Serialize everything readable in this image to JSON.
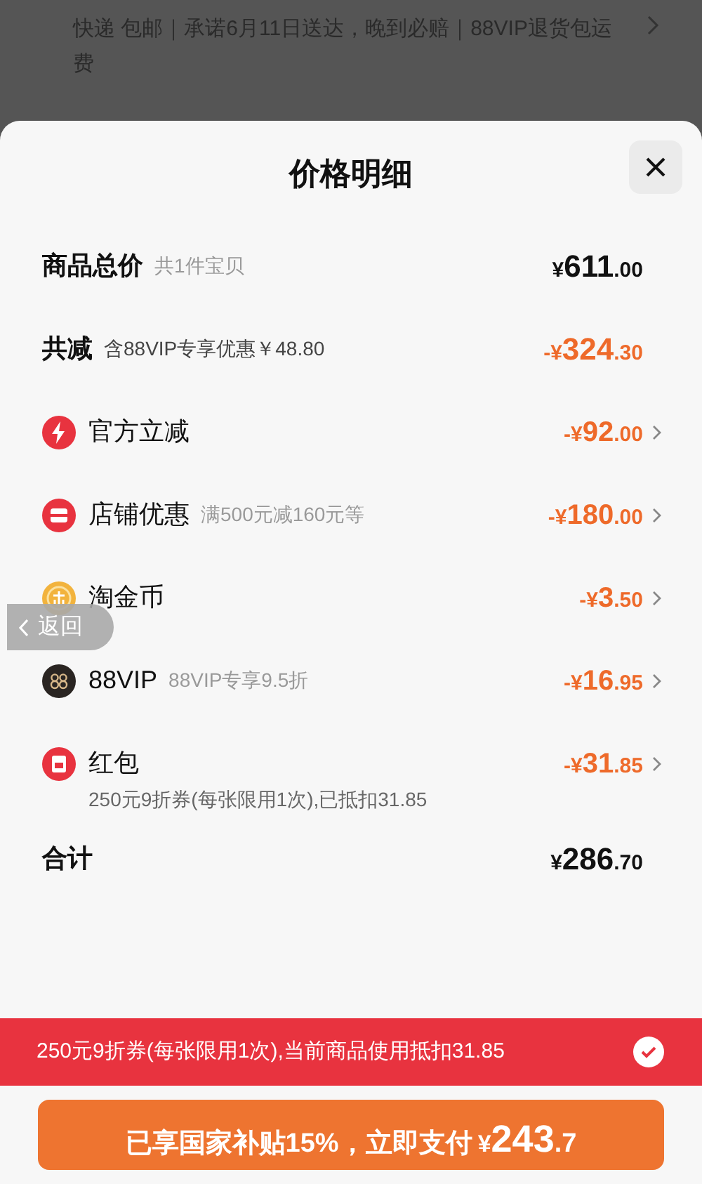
{
  "background": {
    "delivery_text": "快递 包邮｜承诺6月11日送达，晚到必赔｜88VIP退货包运费"
  },
  "sheet": {
    "title": "价格明细",
    "rows": [
      {
        "kind": "subtotal",
        "label": "商品总价",
        "note": "共1件宝贝",
        "price": {
          "sign": "¥",
          "main": "611",
          "cents": ".00"
        }
      },
      {
        "kind": "reduction",
        "label": "共减",
        "note": "含88VIP专享优惠￥48.80",
        "price": {
          "sign": "-¥",
          "main": "324",
          "cents": ".30"
        }
      },
      {
        "kind": "discount",
        "label": "官方立减",
        "price": {
          "sign": "-¥",
          "main": "92",
          "cents": ".00"
        }
      },
      {
        "kind": "discount",
        "label": "店铺优惠",
        "note": "满500元减160元等",
        "price": {
          "sign": "-¥",
          "main": "180",
          "cents": ".00"
        }
      },
      {
        "kind": "discount",
        "label": "淘金币",
        "price": {
          "sign": "-¥",
          "main": "3",
          "cents": ".50"
        }
      },
      {
        "kind": "discount",
        "label": "88VIP",
        "note": "88VIP专享9.5折",
        "price": {
          "sign": "-¥",
          "main": "16",
          "cents": ".95"
        }
      },
      {
        "kind": "discount",
        "label": "红包",
        "detail": "250元9折券(每张限用1次),已抵扣31.85",
        "price": {
          "sign": "-¥",
          "main": "31",
          "cents": ".85"
        }
      },
      {
        "kind": "total",
        "label": "合计",
        "price": {
          "sign": "¥",
          "main": "286",
          "cents": ".70"
        }
      }
    ]
  },
  "back_button": {
    "label": "返回"
  },
  "coupon_bar": {
    "text": "250元9折券(每张限用1次),当前商品使用抵扣31.85",
    "checked": true
  },
  "pay_button": {
    "label": "已享国家补贴15%，立即支付",
    "sign": "¥",
    "main": "243",
    "cents": ".7"
  }
}
